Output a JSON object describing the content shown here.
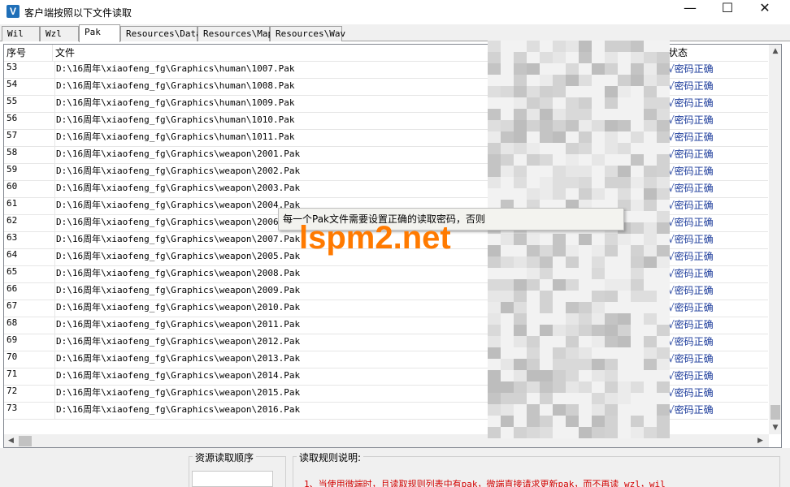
{
  "window": {
    "title": "客户端按照以下文件读取",
    "icon_letter": "V",
    "min_glyph": "—",
    "max_glyph": "☐",
    "close_glyph": "✕"
  },
  "tabs": [
    {
      "label": "Wil",
      "active": false
    },
    {
      "label": "Wzl",
      "active": false
    },
    {
      "label": "Pak",
      "active": true
    },
    {
      "label": "Resources\\Data",
      "active": false
    },
    {
      "label": "Resources\\Map",
      "active": false
    },
    {
      "label": "Resources\\Wav",
      "active": false
    }
  ],
  "table": {
    "columns": {
      "index": "序号",
      "file": "文件",
      "status": "状态"
    },
    "rows": [
      {
        "index": "53",
        "file": "D:\\16周年\\xiaofeng_fg\\Graphics\\human\\1007.Pak",
        "status": "√密码正确"
      },
      {
        "index": "54",
        "file": "D:\\16周年\\xiaofeng_fg\\Graphics\\human\\1008.Pak",
        "status": "√密码正确"
      },
      {
        "index": "55",
        "file": "D:\\16周年\\xiaofeng_fg\\Graphics\\human\\1009.Pak",
        "status": "√密码正确"
      },
      {
        "index": "56",
        "file": "D:\\16周年\\xiaofeng_fg\\Graphics\\human\\1010.Pak",
        "status": "√密码正确"
      },
      {
        "index": "57",
        "file": "D:\\16周年\\xiaofeng_fg\\Graphics\\human\\1011.Pak",
        "status": "√密码正确"
      },
      {
        "index": "58",
        "file": "D:\\16周年\\xiaofeng_fg\\Graphics\\weapon\\2001.Pak",
        "status": "√密码正确"
      },
      {
        "index": "59",
        "file": "D:\\16周年\\xiaofeng_fg\\Graphics\\weapon\\2002.Pak",
        "status": "√密码正确"
      },
      {
        "index": "60",
        "file": "D:\\16周年\\xiaofeng_fg\\Graphics\\weapon\\2003.Pak",
        "status": "√密码正确"
      },
      {
        "index": "61",
        "file": "D:\\16周年\\xiaofeng_fg\\Graphics\\weapon\\2004.Pak",
        "status": "√密码正确"
      },
      {
        "index": "62",
        "file": "D:\\16周年\\xiaofeng_fg\\Graphics\\weapon\\2006.Pak",
        "status": "√密码正确"
      },
      {
        "index": "63",
        "file": "D:\\16周年\\xiaofeng_fg\\Graphics\\weapon\\2007.Pak",
        "status": "√密码正确"
      },
      {
        "index": "64",
        "file": "D:\\16周年\\xiaofeng_fg\\Graphics\\weapon\\2005.Pak",
        "status": "√密码正确"
      },
      {
        "index": "65",
        "file": "D:\\16周年\\xiaofeng_fg\\Graphics\\weapon\\2008.Pak",
        "status": "√密码正确"
      },
      {
        "index": "66",
        "file": "D:\\16周年\\xiaofeng_fg\\Graphics\\weapon\\2009.Pak",
        "status": "√密码正确"
      },
      {
        "index": "67",
        "file": "D:\\16周年\\xiaofeng_fg\\Graphics\\weapon\\2010.Pak",
        "status": "√密码正确"
      },
      {
        "index": "68",
        "file": "D:\\16周年\\xiaofeng_fg\\Graphics\\weapon\\2011.Pak",
        "status": "√密码正确"
      },
      {
        "index": "69",
        "file": "D:\\16周年\\xiaofeng_fg\\Graphics\\weapon\\2012.Pak",
        "status": "√密码正确"
      },
      {
        "index": "70",
        "file": "D:\\16周年\\xiaofeng_fg\\Graphics\\weapon\\2013.Pak",
        "status": "√密码正确"
      },
      {
        "index": "71",
        "file": "D:\\16周年\\xiaofeng_fg\\Graphics\\weapon\\2014.Pak",
        "status": "√密码正确"
      },
      {
        "index": "72",
        "file": "D:\\16周年\\xiaofeng_fg\\Graphics\\weapon\\2015.Pak",
        "status": "√密码正确"
      },
      {
        "index": "73",
        "file": "D:\\16周年\\xiaofeng_fg\\Graphics\\weapon\\2016.Pak",
        "status": "√密码正确"
      }
    ]
  },
  "tooltip": {
    "text": "每一个Pak文件需要设置正确的读取密码，否则"
  },
  "watermark": {
    "text": "lspm2.net",
    "color": "#ff7a00"
  },
  "bottom": {
    "order_group_label": "资源读取顺序",
    "rules_group_label": "读取规则说明:",
    "rule_1": "1、当使用微端时，且读取规则列表中有pak，微端直接请求更新pak，而不再读 wzl，wil"
  },
  "colors": {
    "status_text": "#1a3a9a",
    "rule_text": "#d40000"
  }
}
